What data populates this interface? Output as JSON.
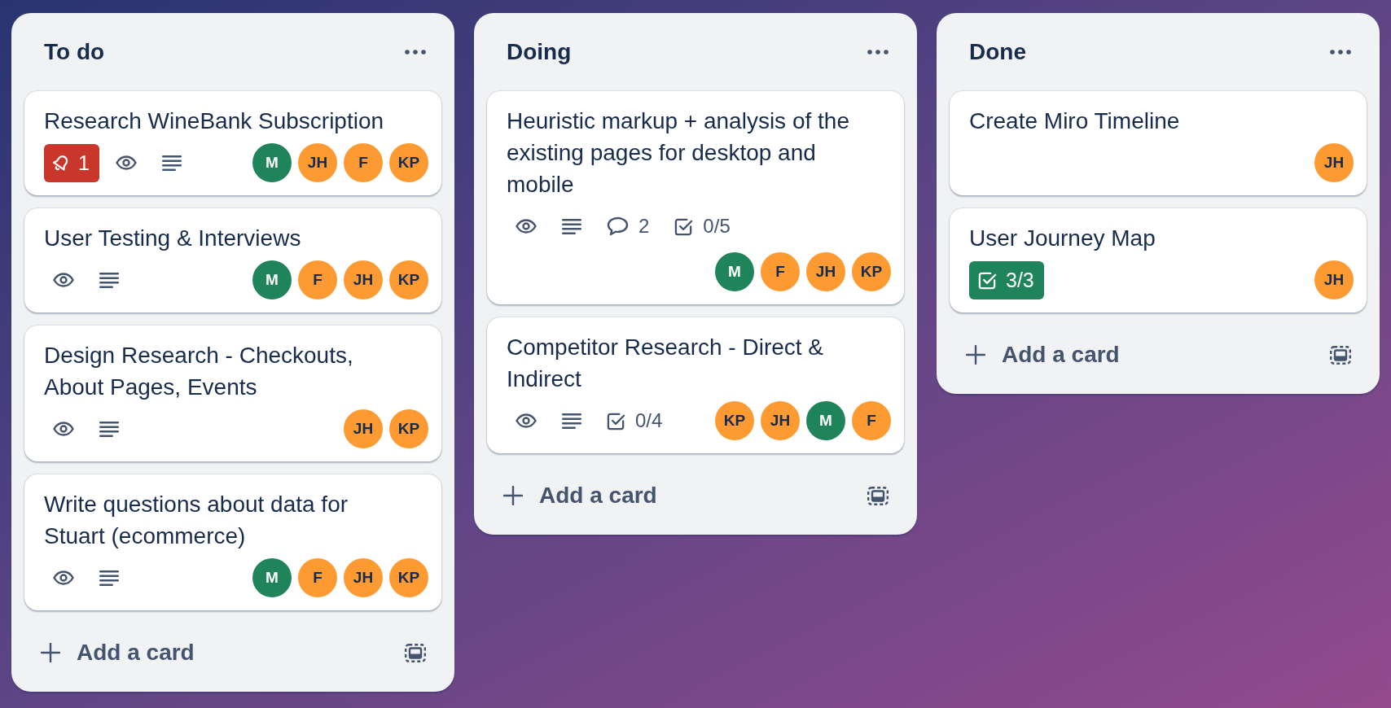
{
  "lists": [
    {
      "title": "To do",
      "cards": [
        {
          "title": "Research WineBank Subscription",
          "badges": [
            {
              "kind": "notifications",
              "text": "1"
            },
            {
              "kind": "watching"
            },
            {
              "kind": "description"
            }
          ],
          "members": [
            {
              "initials": "M",
              "color": "#1f845a"
            },
            {
              "initials": "JH",
              "color": "#fd9a32"
            },
            {
              "initials": "F",
              "color": "#fd9a32"
            },
            {
              "initials": "KP",
              "color": "#fd9a32"
            }
          ]
        },
        {
          "title": "User Testing & Interviews",
          "badges": [
            {
              "kind": "watching"
            },
            {
              "kind": "description"
            }
          ],
          "members": [
            {
              "initials": "M",
              "color": "#1f845a"
            },
            {
              "initials": "F",
              "color": "#fd9a32"
            },
            {
              "initials": "JH",
              "color": "#fd9a32"
            },
            {
              "initials": "KP",
              "color": "#fd9a32"
            }
          ]
        },
        {
          "title": "Design Research - Checkouts, About Pages, Events",
          "badges": [
            {
              "kind": "watching"
            },
            {
              "kind": "description"
            }
          ],
          "members": [
            {
              "initials": "JH",
              "color": "#fd9a32"
            },
            {
              "initials": "KP",
              "color": "#fd9a32"
            }
          ]
        },
        {
          "title": "Write questions about data for Stuart (ecommerce)",
          "badges": [
            {
              "kind": "watching"
            },
            {
              "kind": "description"
            }
          ],
          "members": [
            {
              "initials": "M",
              "color": "#1f845a"
            },
            {
              "initials": "F",
              "color": "#fd9a32"
            },
            {
              "initials": "JH",
              "color": "#fd9a32"
            },
            {
              "initials": "KP",
              "color": "#fd9a32"
            }
          ]
        }
      ],
      "add_card": "Add a card"
    },
    {
      "title": "Doing",
      "cards": [
        {
          "title": "Heuristic markup + analysis of the existing pages for desktop and mobile",
          "badges": [
            {
              "kind": "watching"
            },
            {
              "kind": "description"
            },
            {
              "kind": "comments",
              "text": "2"
            },
            {
              "kind": "checklist",
              "text": "0/5",
              "complete": false
            }
          ],
          "members": [
            {
              "initials": "M",
              "color": "#1f845a"
            },
            {
              "initials": "F",
              "color": "#fd9a32"
            },
            {
              "initials": "JH",
              "color": "#fd9a32"
            },
            {
              "initials": "KP",
              "color": "#fd9a32"
            }
          ]
        },
        {
          "title": "Competitor Research - Direct & Indirect",
          "badges": [
            {
              "kind": "watching"
            },
            {
              "kind": "description"
            },
            {
              "kind": "checklist",
              "text": "0/4",
              "complete": false
            }
          ],
          "members": [
            {
              "initials": "KP",
              "color": "#fd9a32"
            },
            {
              "initials": "JH",
              "color": "#fd9a32"
            },
            {
              "initials": "M",
              "color": "#1f845a"
            },
            {
              "initials": "F",
              "color": "#fd9a32"
            }
          ]
        }
      ],
      "add_card": "Add a card"
    },
    {
      "title": "Done",
      "cards": [
        {
          "title": "Create Miro Timeline",
          "members": [
            {
              "initials": "JH",
              "color": "#fd9a32"
            }
          ]
        },
        {
          "title": "User Journey Map",
          "badges": [
            {
              "kind": "checklist",
              "text": "3/3",
              "complete": true
            }
          ],
          "members": [
            {
              "initials": "JH",
              "color": "#fd9a32"
            }
          ]
        }
      ],
      "add_card": "Add a card"
    }
  ]
}
